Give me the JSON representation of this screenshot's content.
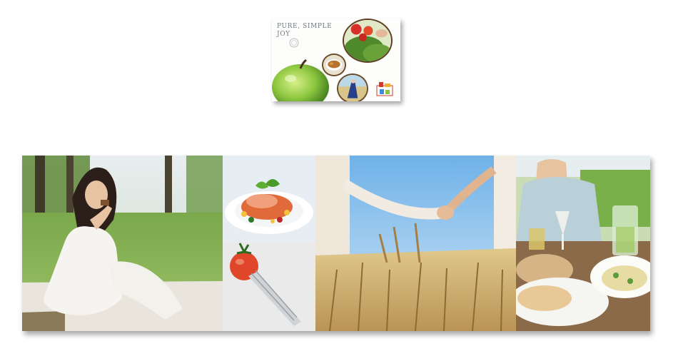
{
  "card": {
    "title": "PURE, SIMPLE JOY",
    "images": [
      "green-apple",
      "berries-circle",
      "soup-bowl-circle",
      "woman-field-circle",
      "brand-logo"
    ]
  },
  "strip": {
    "panels": [
      "woman-eating-on-picnic-blanket",
      "salmon-salad-plate",
      "tomato-and-fork",
      "holding-hands-wheat-field",
      "outdoor-dinner-table"
    ]
  },
  "colors": {
    "card_title": "#6f7a82",
    "grass": "#6f9a3a",
    "sky": "#8fc4ec",
    "wheat": "#c9a86a",
    "tomato": "#e0462a"
  }
}
